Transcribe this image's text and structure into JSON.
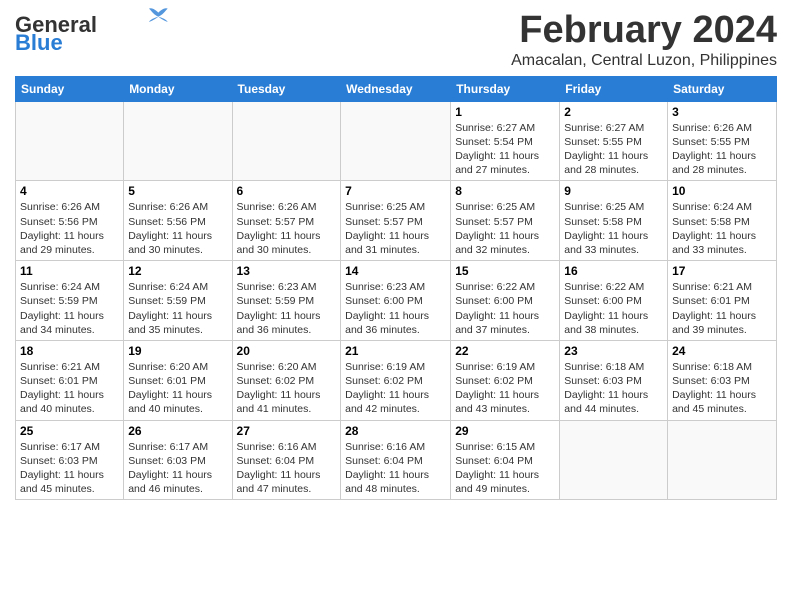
{
  "header": {
    "logo_line1": "General",
    "logo_line2": "Blue",
    "month_title": "February 2024",
    "location": "Amacalan, Central Luzon, Philippines"
  },
  "weekdays": [
    "Sunday",
    "Monday",
    "Tuesday",
    "Wednesday",
    "Thursday",
    "Friday",
    "Saturday"
  ],
  "weeks": [
    [
      {
        "day": "",
        "info": ""
      },
      {
        "day": "",
        "info": ""
      },
      {
        "day": "",
        "info": ""
      },
      {
        "day": "",
        "info": ""
      },
      {
        "day": "1",
        "info": "Sunrise: 6:27 AM\nSunset: 5:54 PM\nDaylight: 11 hours and 27 minutes."
      },
      {
        "day": "2",
        "info": "Sunrise: 6:27 AM\nSunset: 5:55 PM\nDaylight: 11 hours and 28 minutes."
      },
      {
        "day": "3",
        "info": "Sunrise: 6:26 AM\nSunset: 5:55 PM\nDaylight: 11 hours and 28 minutes."
      }
    ],
    [
      {
        "day": "4",
        "info": "Sunrise: 6:26 AM\nSunset: 5:56 PM\nDaylight: 11 hours and 29 minutes."
      },
      {
        "day": "5",
        "info": "Sunrise: 6:26 AM\nSunset: 5:56 PM\nDaylight: 11 hours and 30 minutes."
      },
      {
        "day": "6",
        "info": "Sunrise: 6:26 AM\nSunset: 5:57 PM\nDaylight: 11 hours and 30 minutes."
      },
      {
        "day": "7",
        "info": "Sunrise: 6:25 AM\nSunset: 5:57 PM\nDaylight: 11 hours and 31 minutes."
      },
      {
        "day": "8",
        "info": "Sunrise: 6:25 AM\nSunset: 5:57 PM\nDaylight: 11 hours and 32 minutes."
      },
      {
        "day": "9",
        "info": "Sunrise: 6:25 AM\nSunset: 5:58 PM\nDaylight: 11 hours and 33 minutes."
      },
      {
        "day": "10",
        "info": "Sunrise: 6:24 AM\nSunset: 5:58 PM\nDaylight: 11 hours and 33 minutes."
      }
    ],
    [
      {
        "day": "11",
        "info": "Sunrise: 6:24 AM\nSunset: 5:59 PM\nDaylight: 11 hours and 34 minutes."
      },
      {
        "day": "12",
        "info": "Sunrise: 6:24 AM\nSunset: 5:59 PM\nDaylight: 11 hours and 35 minutes."
      },
      {
        "day": "13",
        "info": "Sunrise: 6:23 AM\nSunset: 5:59 PM\nDaylight: 11 hours and 36 minutes."
      },
      {
        "day": "14",
        "info": "Sunrise: 6:23 AM\nSunset: 6:00 PM\nDaylight: 11 hours and 36 minutes."
      },
      {
        "day": "15",
        "info": "Sunrise: 6:22 AM\nSunset: 6:00 PM\nDaylight: 11 hours and 37 minutes."
      },
      {
        "day": "16",
        "info": "Sunrise: 6:22 AM\nSunset: 6:00 PM\nDaylight: 11 hours and 38 minutes."
      },
      {
        "day": "17",
        "info": "Sunrise: 6:21 AM\nSunset: 6:01 PM\nDaylight: 11 hours and 39 minutes."
      }
    ],
    [
      {
        "day": "18",
        "info": "Sunrise: 6:21 AM\nSunset: 6:01 PM\nDaylight: 11 hours and 40 minutes."
      },
      {
        "day": "19",
        "info": "Sunrise: 6:20 AM\nSunset: 6:01 PM\nDaylight: 11 hours and 40 minutes."
      },
      {
        "day": "20",
        "info": "Sunrise: 6:20 AM\nSunset: 6:02 PM\nDaylight: 11 hours and 41 minutes."
      },
      {
        "day": "21",
        "info": "Sunrise: 6:19 AM\nSunset: 6:02 PM\nDaylight: 11 hours and 42 minutes."
      },
      {
        "day": "22",
        "info": "Sunrise: 6:19 AM\nSunset: 6:02 PM\nDaylight: 11 hours and 43 minutes."
      },
      {
        "day": "23",
        "info": "Sunrise: 6:18 AM\nSunset: 6:03 PM\nDaylight: 11 hours and 44 minutes."
      },
      {
        "day": "24",
        "info": "Sunrise: 6:18 AM\nSunset: 6:03 PM\nDaylight: 11 hours and 45 minutes."
      }
    ],
    [
      {
        "day": "25",
        "info": "Sunrise: 6:17 AM\nSunset: 6:03 PM\nDaylight: 11 hours and 45 minutes."
      },
      {
        "day": "26",
        "info": "Sunrise: 6:17 AM\nSunset: 6:03 PM\nDaylight: 11 hours and 46 minutes."
      },
      {
        "day": "27",
        "info": "Sunrise: 6:16 AM\nSunset: 6:04 PM\nDaylight: 11 hours and 47 minutes."
      },
      {
        "day": "28",
        "info": "Sunrise: 6:16 AM\nSunset: 6:04 PM\nDaylight: 11 hours and 48 minutes."
      },
      {
        "day": "29",
        "info": "Sunrise: 6:15 AM\nSunset: 6:04 PM\nDaylight: 11 hours and 49 minutes."
      },
      {
        "day": "",
        "info": ""
      },
      {
        "day": "",
        "info": ""
      }
    ]
  ]
}
